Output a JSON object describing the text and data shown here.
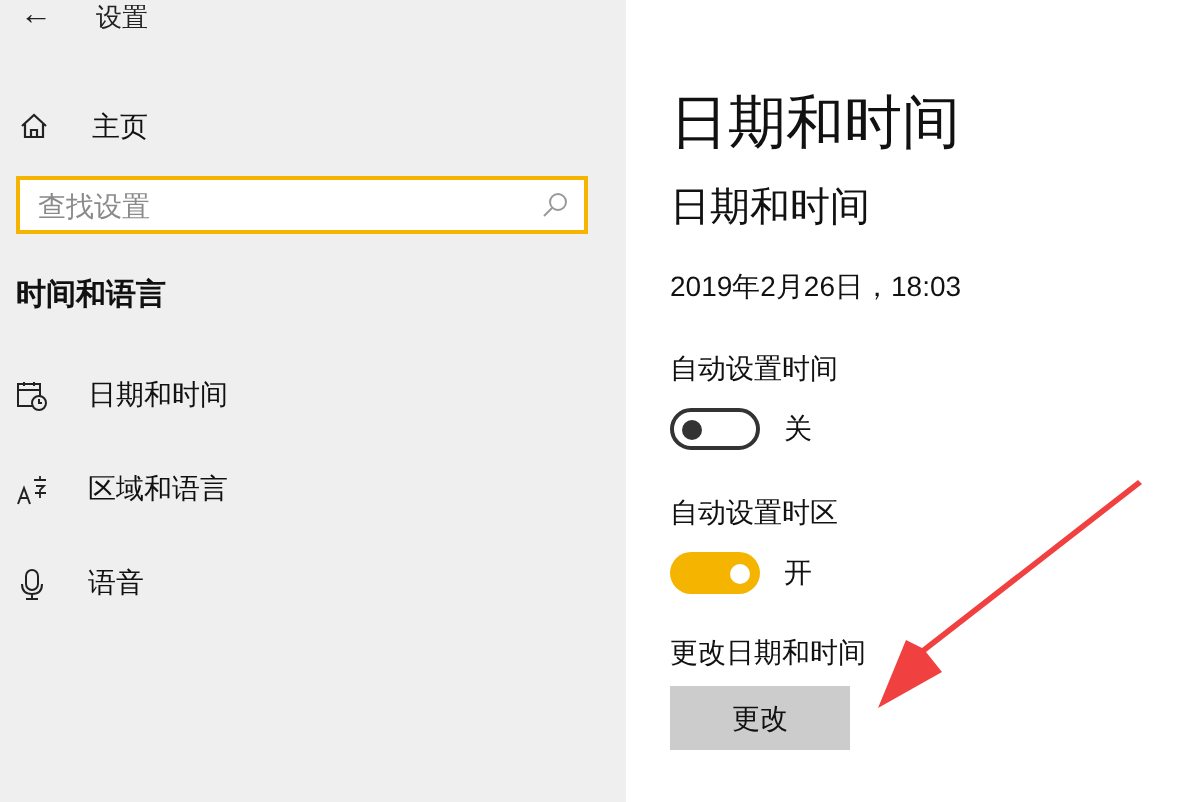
{
  "window": {
    "title": "设置",
    "back": "←"
  },
  "sidebar": {
    "home": "主页",
    "search": {
      "placeholder": "查找设置"
    },
    "section": "时间和语言",
    "items": [
      {
        "kind": "calendar",
        "label": "日期和时间"
      },
      {
        "kind": "language",
        "label": "区域和语言"
      },
      {
        "kind": "mic",
        "label": "语音"
      }
    ]
  },
  "content": {
    "title": "日期和时间",
    "subtitle": "日期和时间",
    "datetime": "2019年2月26日，18:03",
    "toggles": [
      {
        "label": "自动设置时间",
        "on": false,
        "state": "关"
      },
      {
        "label": "自动设置时区",
        "on": true,
        "state": "开"
      }
    ],
    "change": {
      "label": "更改日期和时间",
      "button": "更改"
    }
  }
}
